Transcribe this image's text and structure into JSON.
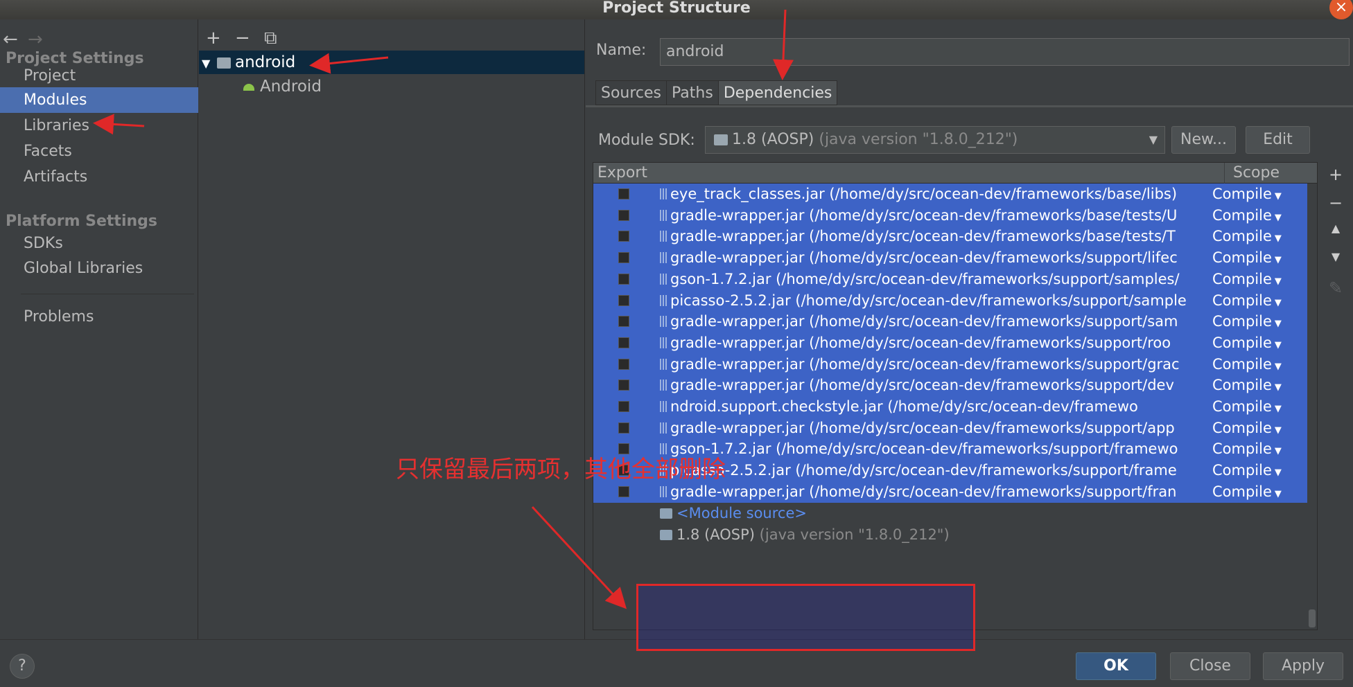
{
  "window": {
    "title": "Project Structure",
    "close_icon": "close-icon"
  },
  "sidebar": {
    "nav_back": "←",
    "nav_forward": "→",
    "section_project": "Project Settings",
    "project_items": [
      "Project",
      "Modules",
      "Libraries",
      "Facets",
      "Artifacts"
    ],
    "section_platform": "Platform Settings",
    "platform_items": [
      "SDKs",
      "Global Libraries"
    ],
    "problems": "Problems",
    "selected": "Modules"
  },
  "tree": {
    "tools": [
      "+",
      "−",
      "⧉"
    ],
    "root_arrow": "▼",
    "root": "android",
    "child": "Android"
  },
  "module": {
    "name_label": "Name:",
    "name_value": "android",
    "tabs": [
      "Sources",
      "Paths",
      "Dependencies"
    ],
    "active_tab": "Dependencies",
    "sdk_label": "Module SDK:",
    "sdk_value": "1.8 (AOSP)",
    "sdk_detail": "(java version \"1.8.0_212\")",
    "new_button": "New...",
    "edit_button": "Edit"
  },
  "deps_table": {
    "col_export": "Export",
    "col_scope": "Scope",
    "rows": [
      {
        "text": "eye_track_classes.jar (/home/dy/src/ocean-dev/frameworks/base/libs)",
        "scope": "Compile"
      },
      {
        "text": "gradle-wrapper.jar (/home/dy/src/ocean-dev/frameworks/base/tests/U",
        "scope": "Compile"
      },
      {
        "text": "gradle-wrapper.jar (/home/dy/src/ocean-dev/frameworks/base/tests/T",
        "scope": "Compile"
      },
      {
        "text": "gradle-wrapper.jar (/home/dy/src/ocean-dev/frameworks/support/lifec",
        "scope": "Compile"
      },
      {
        "text": "gson-1.7.2.jar (/home/dy/src/ocean-dev/frameworks/support/samples/",
        "scope": "Compile"
      },
      {
        "text": "picasso-2.5.2.jar (/home/dy/src/ocean-dev/frameworks/support/sample",
        "scope": "Compile"
      },
      {
        "text": "gradle-wrapper.jar (/home/dy/src/ocean-dev/frameworks/support/sam",
        "scope": "Compile"
      },
      {
        "text": "gradle-wrapper.jar (/home/dy/src/ocean-dev/frameworks/support/roo",
        "scope": "Compile"
      },
      {
        "text": "gradle-wrapper.jar (/home/dy/src/ocean-dev/frameworks/support/grac",
        "scope": "Compile"
      },
      {
        "text": "gradle-wrapper.jar (/home/dy/src/ocean-dev/frameworks/support/dev",
        "scope": "Compile"
      },
      {
        "text": "ndroid.support.checkstyle.jar (/home/dy/src/ocean-dev/framewo",
        "scope": "Compile"
      },
      {
        "text": "gradle-wrapper.jar (/home/dy/src/ocean-dev/frameworks/support/app",
        "scope": "Compile"
      },
      {
        "text": "gson-1.7.2.jar (/home/dy/src/ocean-dev/frameworks/support/framewo",
        "scope": "Compile"
      },
      {
        "text": "picasso-2.5.2.jar (/home/dy/src/ocean-dev/frameworks/support/frame",
        "scope": "Compile"
      },
      {
        "text": "gradle-wrapper.jar (/home/dy/src/ocean-dev/frameworks/support/fran",
        "scope": "Compile"
      }
    ],
    "module_source": "<Module source>",
    "sdk_entry": "1.8 (AOSP)",
    "sdk_entry_detail": "(java version \"1.8.0_212\")"
  },
  "side_tools": [
    "+",
    "−",
    "▲",
    "▼",
    "✎"
  ],
  "footer": {
    "help": "?",
    "ok": "OK",
    "close": "Close",
    "apply": "Apply"
  },
  "annotation": {
    "text": "只保留最后两项，其他全部删除",
    "color": "#e53030"
  },
  "colors": {
    "selection": "#4b6eaf",
    "table_selection": "#3d63c6",
    "annotation_red": "#e02828"
  }
}
